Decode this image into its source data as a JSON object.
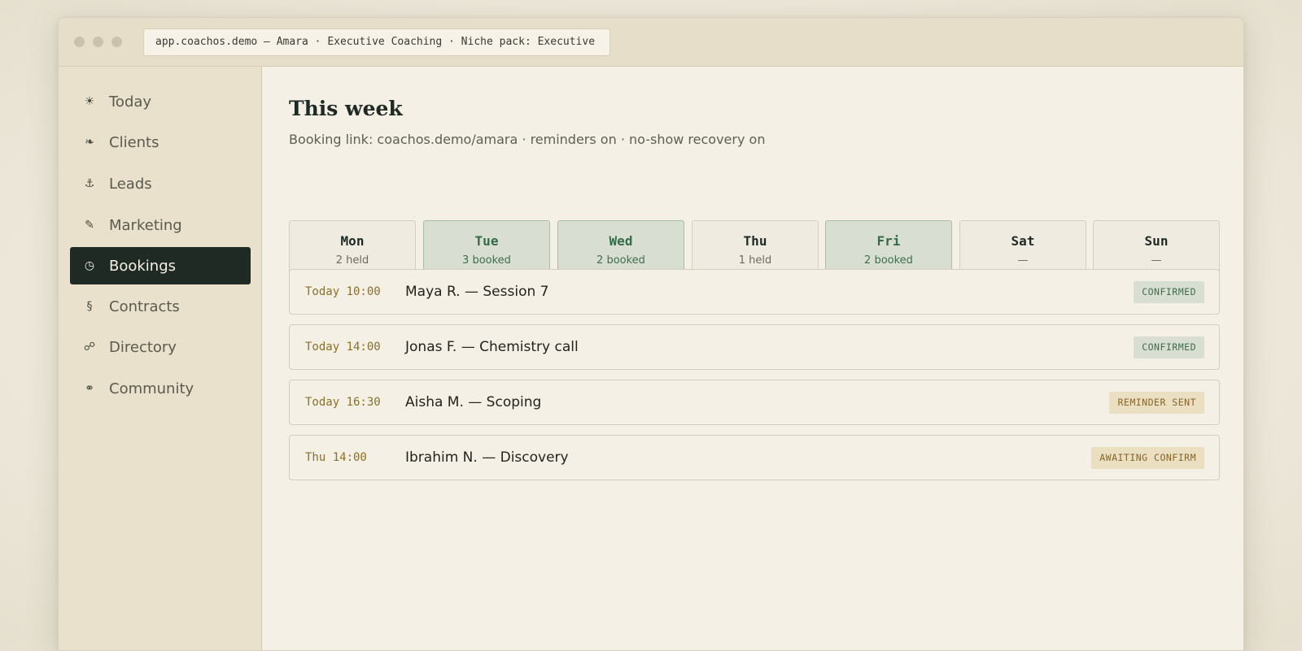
{
  "window": {
    "address": "app.coachos.demo — Amara · Executive Coaching · Niche pack: Executive"
  },
  "sidebar": {
    "items": [
      {
        "label": "Today",
        "icon": "sun-icon",
        "glyph": "☀"
      },
      {
        "label": "Clients",
        "icon": "leaf-icon",
        "glyph": "❧"
      },
      {
        "label": "Leads",
        "icon": "anchor-icon",
        "glyph": "⚓"
      },
      {
        "label": "Marketing",
        "icon": "pencil-icon",
        "glyph": "✎"
      },
      {
        "label": "Bookings",
        "icon": "clock-icon",
        "glyph": "◷",
        "active": true
      },
      {
        "label": "Contracts",
        "icon": "section-icon",
        "glyph": "§"
      },
      {
        "label": "Directory",
        "icon": "link-icon",
        "glyph": "☍"
      },
      {
        "label": "Community",
        "icon": "rings-icon",
        "glyph": "⚭"
      }
    ]
  },
  "main": {
    "title": "This week",
    "subtitle": "Booking link: coachos.demo/amara · reminders on · no-show recovery on",
    "days": [
      {
        "name": "Mon",
        "status": "2 held",
        "booked": false
      },
      {
        "name": "Tue",
        "status": "3 booked",
        "booked": true
      },
      {
        "name": "Wed",
        "status": "2 booked",
        "booked": true
      },
      {
        "name": "Thu",
        "status": "1 held",
        "booked": false
      },
      {
        "name": "Fri",
        "status": "2 booked",
        "booked": true
      },
      {
        "name": "Sat",
        "status": "—",
        "booked": false
      },
      {
        "name": "Sun",
        "status": "—",
        "booked": false
      }
    ],
    "bookings": [
      {
        "time": "Today 10:00",
        "title": "Maya R. — Session 7",
        "status": "CONFIRMED",
        "tone": "green"
      },
      {
        "time": "Today 14:00",
        "title": "Jonas F. — Chemistry call",
        "status": "CONFIRMED",
        "tone": "green"
      },
      {
        "time": "Today 16:30",
        "title": "Aisha M. — Scoping",
        "status": "REMINDER SENT",
        "tone": "amber"
      },
      {
        "time": "Thu 14:00",
        "title": "Ibrahim N. — Discovery",
        "status": "AWAITING CONFIRM",
        "tone": "amber"
      }
    ]
  },
  "colors": {
    "accent_dark": "#1f2a24",
    "booked_green": "#356b48",
    "time_amber": "#8a7028"
  }
}
